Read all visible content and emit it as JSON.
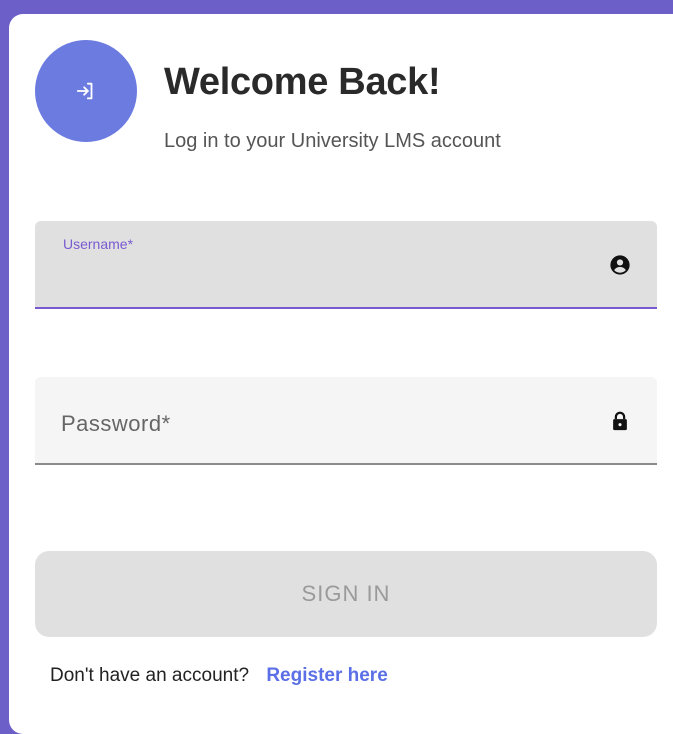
{
  "header": {
    "icon": "login-arrow-icon",
    "title": "Welcome Back!",
    "subtitle": "Log in to your University LMS account"
  },
  "form": {
    "username": {
      "label": "Username*",
      "value": "",
      "icon": "account-circle-icon",
      "state": "focused"
    },
    "password": {
      "label": "Password*",
      "value": "",
      "icon": "lock-icon",
      "state": "idle"
    },
    "submit_label": "SIGN IN",
    "submit_state": "disabled"
  },
  "footer": {
    "prompt": "Don't have an account?",
    "link_label": "Register here"
  },
  "colors": {
    "accent": "#6b7be0",
    "focus": "#7a5ad0",
    "link": "#5b6fe6",
    "frame": "#6c5fc7"
  }
}
